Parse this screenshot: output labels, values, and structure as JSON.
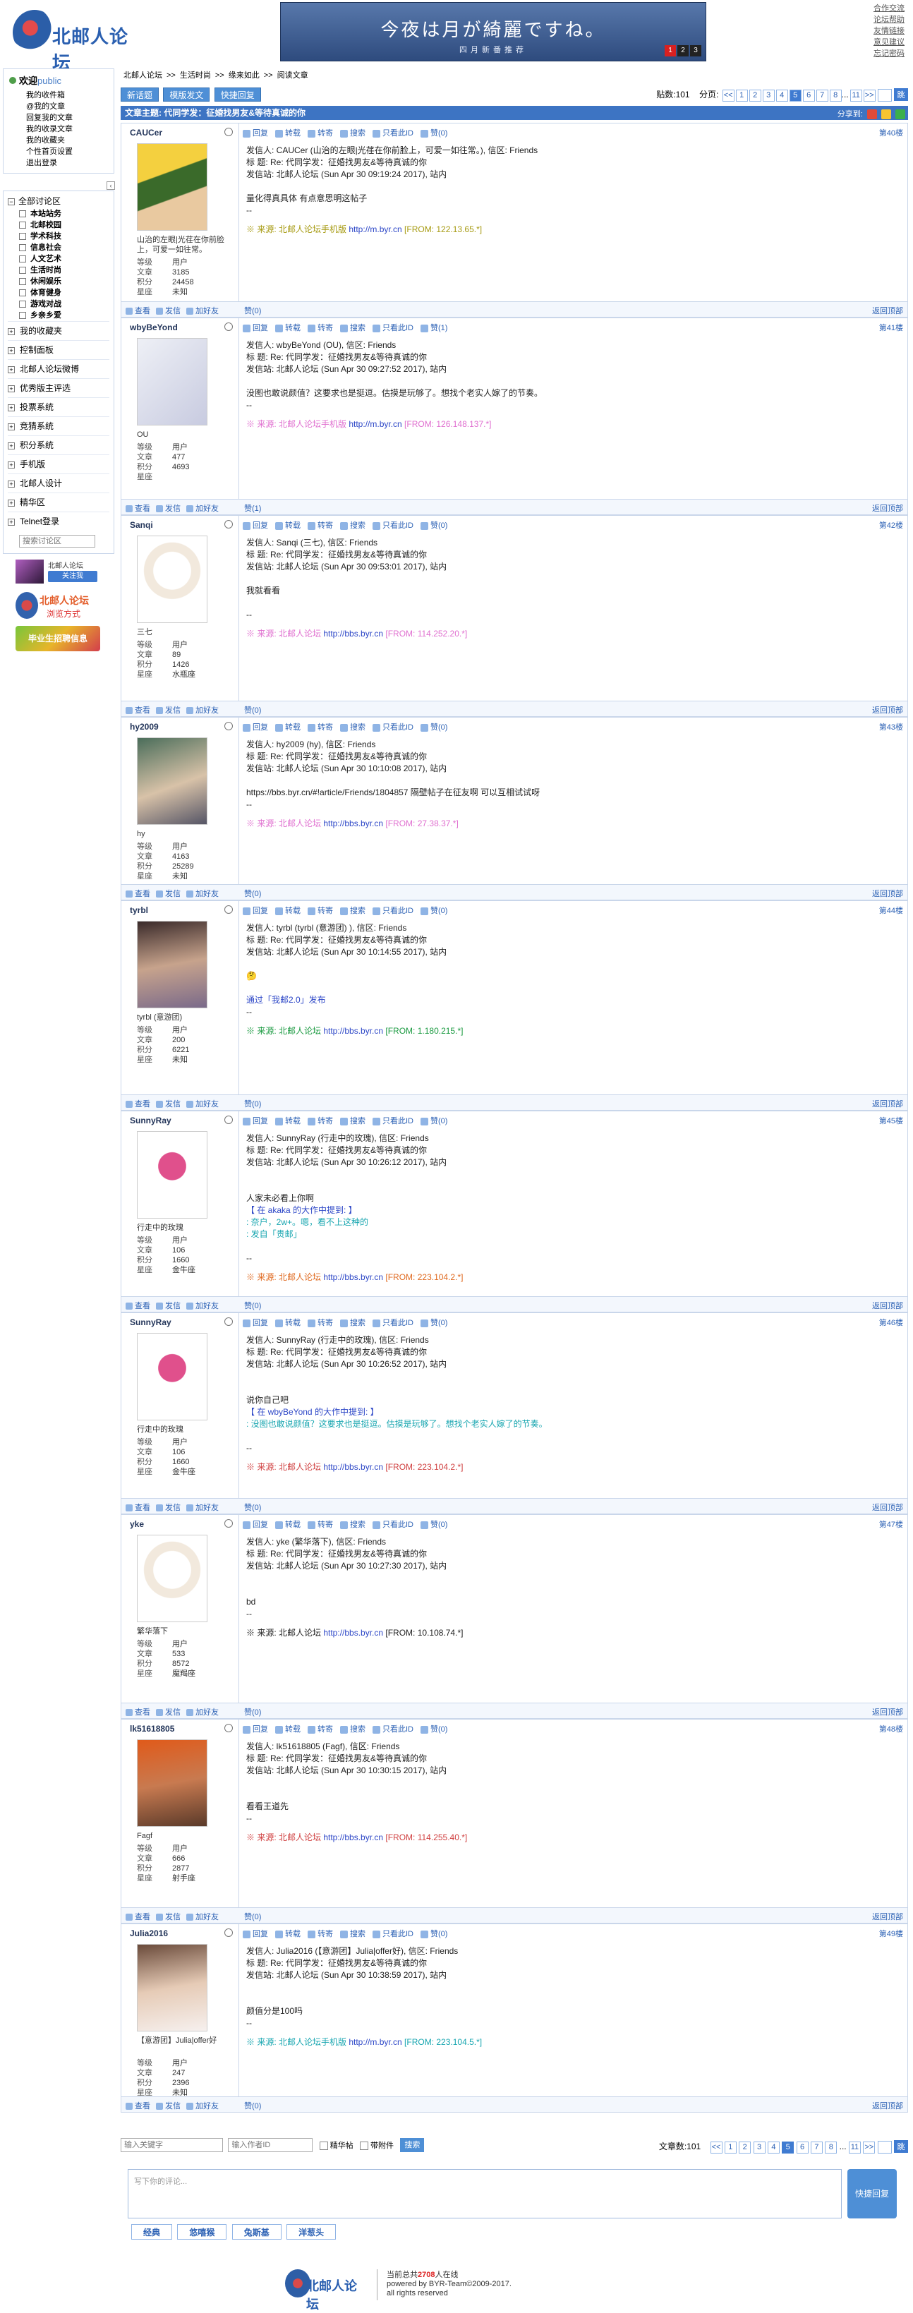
{
  "top": {
    "logo_text": "北邮人论坛",
    "banner_title": "今夜は月が綺麗ですね。",
    "banner_sub": "四月新番推荐",
    "banner_pages": [
      "1",
      "2",
      "3"
    ],
    "links": [
      "合作交流",
      "论坛帮助",
      "友情链接",
      "意见建议",
      "忘记密码"
    ]
  },
  "welcome": {
    "title": "欢迎",
    "user": "public",
    "links": [
      "我的收件箱",
      "@我的文章",
      "回复我的文章",
      "我的收录文章",
      "我的收藏夹",
      "个性首页设置",
      "退出登录"
    ]
  },
  "tree": {
    "root": "全部讨论区",
    "boards": [
      "本站站务",
      "北邮校园",
      "学术科技",
      "信息社会",
      "人文艺术",
      "生活时尚",
      "休闲娱乐",
      "体育健身",
      "游戏对战",
      "乡亲乡爱"
    ],
    "items": [
      "我的收藏夹",
      "控制面板",
      "北邮人论坛微博",
      "优秀版主评选",
      "投票系统",
      "竞猜系统",
      "积分系统",
      "手机版",
      "北邮人设计",
      "精华区",
      "Telnet登录"
    ],
    "search_placeholder": "搜索讨论区"
  },
  "ads": {
    "ad1_t1": "北邮人论坛",
    "ad1_t2": "关注我",
    "ad2_t1": "北邮人论坛",
    "ad2_t2": "浏览方式",
    "ad3": "毕业生招聘信息"
  },
  "crumb": [
    "北邮人论坛",
    ">>",
    "生活时尚",
    ">>",
    "缘来如此",
    ">>",
    "阅读文章"
  ],
  "toolbar": {
    "btn_new": "新话题",
    "btn_post": "模版发文",
    "btn_reply": "快捷回复",
    "count_label": "贴数:101",
    "page_label": "分页:",
    "pages": [
      "<<",
      "1",
      "2",
      "3",
      "4",
      "5",
      "6",
      "7",
      "8",
      "...",
      "11",
      ">>"
    ],
    "current": "5",
    "go": "跳"
  },
  "article": {
    "title": "文章主题: 代同学发：征婚找男友&等待真诚的你",
    "share": "分享到:"
  },
  "labels": {
    "level": "等级",
    "posts": "文章",
    "score": "积分",
    "star": "星座",
    "tools": [
      "回复",
      "转载",
      "转寄",
      "搜索",
      "只看此ID"
    ],
    "bottom": [
      "查看",
      "发信",
      "加好友"
    ],
    "totop": "返回顶部"
  },
  "posts": [
    {
      "id": "CAUCer",
      "floor": "第40楼",
      "nick": "山治的左眼|光荏在你前脸上，可爱一如往常。",
      "level": "用户",
      "posts": "3185",
      "score": "24458",
      "star": "未知",
      "praise": "赞(0)",
      "header": [
        "发信人: CAUCer (山治的左眼|光荏在你前脸上，可爱一如往常。), 信区: Friends",
        "标  题: Re: 代同学发：征婚找男友&等待真诚的你",
        "发信站: 北邮人论坛 (Sun Apr 30 09:19:24 2017), 站内"
      ],
      "text": [
        "量化得真具体 有点意思明这帖子",
        "--"
      ],
      "src": "※ 来源: 北邮人论坛手机版 ",
      "srclink": "http://m.byr.cn",
      "ip": " [FROM: 122.13.65.*]",
      "srcclass": "c-olive"
    },
    {
      "id": "wbyBeYond",
      "floor": "第41楼",
      "nick": "OU",
      "level": "用户",
      "posts": "477",
      "score": "4693",
      "star": "",
      "praise": "赞(1)",
      "header": [
        "发信人: wbyBeYond (OU), 信区: Friends",
        "标  题: Re: 代同学发：征婚找男友&等待真诚的你",
        "发信站: 北邮人论坛 (Sun Apr 30 09:27:52 2017), 站内"
      ],
      "text": [
        "没图也敢说颜值？这要求也是挺逗。估摸是玩够了。想找个老实人嫁了的节奏。",
        "--"
      ],
      "src": "※ 来源: 北邮人论坛手机版 ",
      "srclink": "http://m.byr.cn",
      "ip": " [FROM: 126.148.137.*]",
      "srcclass": "c-pink"
    },
    {
      "id": "Sanqi",
      "floor": "第42楼",
      "nick": "三七",
      "level": "用户",
      "posts": "89",
      "score": "1426",
      "star": "水瓶座",
      "praise": "赞(0)",
      "header": [
        "发信人: Sanqi (三七), 信区: Friends",
        "标  题: Re: 代同学发：征婚找男友&等待真诚的你",
        "发信站: 北邮人论坛 (Sun Apr 30 09:53:01 2017), 站内"
      ],
      "text": [
        "我就看看",
        "",
        "--"
      ],
      "src": "※ 来源: 北邮人论坛 ",
      "srclink": "http://bbs.byr.cn",
      "ip": " [FROM: 114.252.20.*]",
      "srcclass": "c-pink"
    },
    {
      "id": "hy2009",
      "floor": "第43楼",
      "nick": "hy",
      "level": "用户",
      "posts": "4163",
      "score": "25289",
      "star": "未知",
      "praise": "赞(0)",
      "header": [
        "发信人: hy2009 (hy), 信区: Friends",
        "标  题: Re: 代同学发：征婚找男友&等待真诚的你",
        "发信站: 北邮人论坛 (Sun Apr 30 10:10:08 2017), 站内"
      ],
      "text": [
        "https://bbs.byr.cn/#!article/Friends/1804857 隔壁帖子在征友啊  可以互相试试呀",
        "--"
      ],
      "src": "※ 来源: 北邮人论坛 ",
      "srclink": "http://bbs.byr.cn",
      "ip": " [FROM: 27.38.37.*]",
      "srcclass": "c-pink"
    },
    {
      "id": "tyrbl",
      "floor": "第44楼",
      "nick": "tyrbl (意游团)",
      "level": "用户",
      "posts": "200",
      "score": "6221",
      "star": "未知",
      "praise": "赞(0)",
      "header": [
        "发信人: tyrbl (tyrbl (意游团) ), 信区: Friends",
        "标  题: Re: 代同学发：征婚找男友&等待真诚的你",
        "发信站: 北邮人论坛 (Sun Apr 30 10:14:55 2017), 站内"
      ],
      "text": [
        "🤔",
        "",
        "通过「我邮2.0」发布",
        "--"
      ],
      "src": "※ 来源: 北邮人论坛 ",
      "srclink": "http://bbs.byr.cn",
      "ip": " [FROM: 1.180.215.*]",
      "srcclass": "c-green"
    },
    {
      "id": "SunnyRay",
      "floor": "第45楼",
      "nick": "行走中的玫瑰",
      "level": "用户",
      "posts": "106",
      "score": "1660",
      "star": "金牛座",
      "praise": "赞(0)",
      "header": [
        "发信人: SunnyRay (行走中的玫瑰), 信区: Friends",
        "标  题: Re: 代同学发：征婚找男友&等待真诚的你",
        "发信站: 北邮人论坛 (Sun Apr 30 10:26:12 2017), 站内"
      ],
      "text": [
        "",
        "人家未必看上你啊",
        "【 在 akaka 的大作中提到: 】",
        ": 奈户，2w+。嗯，看不上这种的",
        ": 发自「贵邮」",
        "",
        "--"
      ],
      "src": "※ 来源: 北邮人论坛 ",
      "srclink": "http://bbs.byr.cn",
      "ip": " [FROM: 223.104.2.*]",
      "srcclass": "c-orange"
    },
    {
      "id": "SunnyRay",
      "floor": "第46楼",
      "nick": "行走中的玫瑰",
      "level": "用户",
      "posts": "106",
      "score": "1660",
      "star": "金牛座",
      "praise": "赞(0)",
      "header": [
        "发信人: SunnyRay (行走中的玫瑰), 信区: Friends",
        "标  题: Re: 代同学发：征婚找男友&等待真诚的你",
        "发信站: 北邮人论坛 (Sun Apr 30 10:26:52 2017), 站内"
      ],
      "text": [
        "",
        "说你自己吧",
        "【 在 wbyBeYond 的大作中提到: 】",
        ": 没图也敢说颜值？这要求也是挺逗。估摸是玩够了。想找个老实人嫁了的节奏。",
        "",
        "--"
      ],
      "src": "※ 来源: 北邮人论坛 ",
      "srclink": "http://bbs.byr.cn",
      "ip": " [FROM: 223.104.2.*]",
      "srcclass": "c-red"
    },
    {
      "id": "yke",
      "floor": "第47楼",
      "nick": "繁华落下",
      "level": "用户",
      "posts": "533",
      "score": "8572",
      "star": "魔羯座",
      "praise": "赞(0)",
      "header": [
        "发信人: yke (繁华落下), 信区: Friends",
        "标  题: Re: 代同学发：征婚找男友&等待真诚的你",
        "发信站: 北邮人论坛 (Sun Apr 30 10:27:30 2017), 站内"
      ],
      "text": [
        "",
        "bd",
        "--"
      ],
      "src": "※ 来源: 北邮人论坛 ",
      "srclink": "http://bbs.byr.cn",
      "ip": " [FROM: 10.108.74.*]",
      "srcclass": ""
    },
    {
      "id": "lk51618805",
      "floor": "第48楼",
      "nick": "Fagf",
      "level": "用户",
      "posts": "666",
      "score": "2877",
      "star": "射手座",
      "praise": "赞(0)",
      "header": [
        "发信人: lk51618805 (Fagf), 信区: Friends",
        "标  题: Re: 代同学发：征婚找男友&等待真诚的你",
        "发信站: 北邮人论坛 (Sun Apr 30 10:30:15 2017), 站内"
      ],
      "text": [
        "",
        "看看王道先",
        "--"
      ],
      "src": "※ 来源: 北邮人论坛 ",
      "srclink": "http://bbs.byr.cn",
      "ip": " [FROM: 114.255.40.*]",
      "srcclass": "c-red"
    },
    {
      "id": "Julia2016",
      "floor": "第49楼",
      "nick": "【意游团】Julia|offer好",
      "level": "用户",
      "posts": "247",
      "score": "2396",
      "star": "未知",
      "praise": "赞(0)",
      "header": [
        "发信人: Julia2016 (【意游团】Julia|offer好), 信区: Friends",
        "标  题: Re: 代同学发：征婚找男友&等待真诚的你",
        "发信站: 北邮人论坛 (Sun Apr 30 10:38:59 2017), 站内"
      ],
      "text": [
        "",
        "颜值分是100吗",
        "--"
      ],
      "src": "※ 来源: 北邮人论坛手机版 ",
      "srclink": "http://m.byr.cn",
      "ip": " [FROM: 223.104.5.*]",
      "srcclass": "c-teal"
    }
  ],
  "bottom": {
    "kw_placeholder": "输入关键字",
    "author_placeholder": "输入作者ID",
    "chk1": "精华帖",
    "chk2": "带附件",
    "search": "搜索",
    "count": "文章数:101"
  },
  "quick": {
    "placeholder": "写下你的评论...",
    "btn": "快捷回复",
    "tabs": [
      "经典",
      "悠嘻猴",
      "兔斯基",
      "洋葱头"
    ]
  },
  "footer": {
    "logo": "北邮人论坛",
    "online_pre": "当前总共",
    "online": "2708",
    "online_post": "人在线",
    "powered": "powered by BYR-Team©2009-2017.",
    "rights": "all rights reserved"
  }
}
